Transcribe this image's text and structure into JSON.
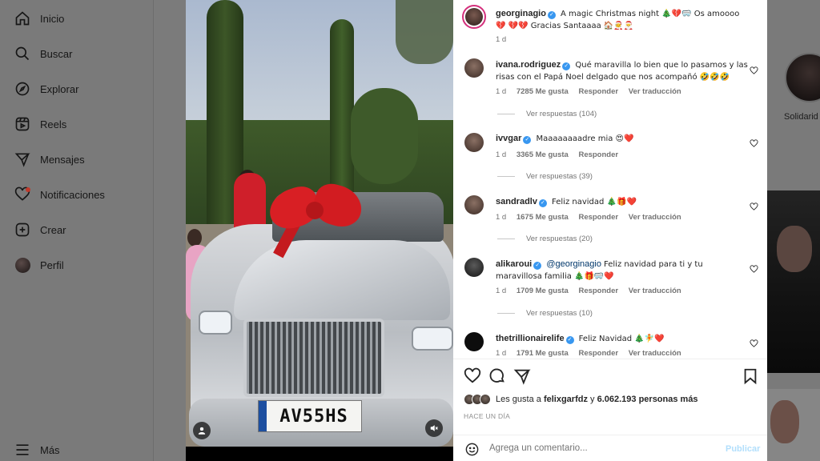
{
  "sidebar": {
    "items": [
      {
        "label": "Inicio",
        "icon": "home-icon"
      },
      {
        "label": "Buscar",
        "icon": "search-icon"
      },
      {
        "label": "Explorar",
        "icon": "compass-icon"
      },
      {
        "label": "Reels",
        "icon": "reels-icon"
      },
      {
        "label": "Mensajes",
        "icon": "send-icon"
      },
      {
        "label": "Notificaciones",
        "icon": "heart-icon"
      },
      {
        "label": "Crear",
        "icon": "plus-square-icon"
      },
      {
        "label": "Perfil",
        "icon": "avatar"
      }
    ],
    "more_label": "Más"
  },
  "background": {
    "story_label": "Solidarid"
  },
  "media": {
    "plate": "AV55HS"
  },
  "post": {
    "author": "georginagio",
    "caption": "A magic Christmas night 🎄💔🥽 Os amoooo💔 💔💔 Gracias Santaaaa 🏠🧑‍🎄🎅",
    "time": "1 d"
  },
  "comments": [
    {
      "user": "ivana.rodriguez",
      "text": "Qué maravilla lo bien que lo pasamos y las risas con el Papá Noel delgado que nos acompañó 🤣🤣🤣",
      "time": "1 d",
      "likes": "7285 Me gusta",
      "reply": "Responder",
      "translate": "Ver traducción",
      "replies": "Ver respuestas (104)"
    },
    {
      "user": "ivvgar",
      "text": "Maaaaaaaadre mia 😍❤️",
      "time": "1 d",
      "likes": "3365 Me gusta",
      "reply": "Responder",
      "translate": "",
      "replies": "Ver respuestas (39)"
    },
    {
      "user": "sandradlv",
      "text": "Feliz navidad 🎄🎁❤️",
      "time": "1 d",
      "likes": "1675 Me gusta",
      "reply": "Responder",
      "translate": "Ver traducción",
      "replies": "Ver respuestas (20)"
    },
    {
      "user": "alikaroui",
      "mention": "@georginagio",
      "text": "Feliz navidad para ti y tu maravillosa familia 🎄🎁🥽❤️",
      "time": "1 d",
      "likes": "1709 Me gusta",
      "reply": "Responder",
      "translate": "Ver traducción",
      "replies": "Ver respuestas (10)"
    },
    {
      "user": "thetrillionairelife",
      "text": "Feliz Navidad 🎄🧚❤️",
      "time": "1 d",
      "likes": "1791 Me gusta",
      "reply": "Responder",
      "translate": "Ver traducción"
    }
  ],
  "likes": {
    "prefix": "Les gusta a",
    "user": "felixgarfdz",
    "connector": "y",
    "count": "6.062.193 personas más"
  },
  "time_label": "HACE UN DÍA",
  "comment_box": {
    "placeholder": "Agrega un comentario...",
    "publish": "Publicar"
  },
  "colors": {
    "accent": "#3897f0",
    "publish_disabled": "#b2dffc",
    "overlay": "#7b7b7b"
  }
}
